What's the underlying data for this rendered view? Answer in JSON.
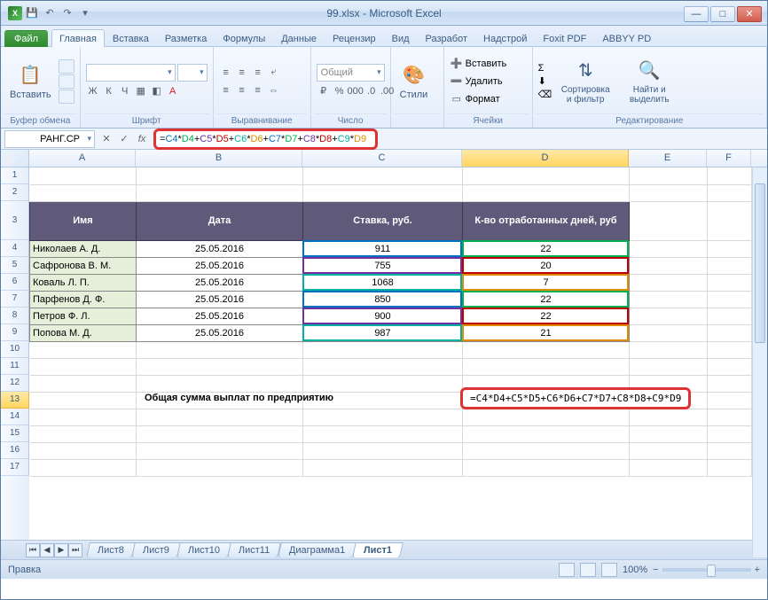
{
  "window": {
    "title": "99.xlsx - Microsoft Excel"
  },
  "tabs": {
    "file": "Файл",
    "items": [
      "Главная",
      "Вставка",
      "Разметка",
      "Формулы",
      "Данные",
      "Рецензир",
      "Вид",
      "Разработ",
      "Надстрой",
      "Foxit PDF",
      "ABBYY PD"
    ],
    "active": 0
  },
  "ribbon": {
    "clipboard": {
      "paste": "Вставить",
      "label": "Буфер обмена"
    },
    "font": {
      "label": "Шрифт",
      "bold": "Ж",
      "italic": "К",
      "underline": "Ч"
    },
    "align": {
      "label": "Выравнивание"
    },
    "number": {
      "format": "Общий",
      "label": "Число"
    },
    "styles": {
      "btn": "Стили",
      "label": ""
    },
    "cells": {
      "insert": "Вставить",
      "delete": "Удалить",
      "format": "Формат",
      "label": "Ячейки"
    },
    "editing": {
      "sort": "Сортировка и фильтр",
      "find": "Найти и выделить",
      "label": "Редактирование"
    }
  },
  "formula_bar": {
    "name_box": "РАНГ.СР",
    "parts": [
      {
        "t": "=",
        "c": ""
      },
      {
        "t": "C4",
        "c": "c1"
      },
      {
        "t": "*",
        "c": ""
      },
      {
        "t": "D4",
        "c": "c2"
      },
      {
        "t": "+",
        "c": ""
      },
      {
        "t": "C5",
        "c": "c3"
      },
      {
        "t": "*",
        "c": ""
      },
      {
        "t": "D5",
        "c": "c4"
      },
      {
        "t": "+",
        "c": ""
      },
      {
        "t": "C6",
        "c": "c5"
      },
      {
        "t": "*",
        "c": ""
      },
      {
        "t": "D6",
        "c": "c6"
      },
      {
        "t": "+",
        "c": ""
      },
      {
        "t": "C7",
        "c": "c1"
      },
      {
        "t": "*",
        "c": ""
      },
      {
        "t": "D7",
        "c": "c2"
      },
      {
        "t": "+",
        "c": ""
      },
      {
        "t": "C8",
        "c": "c3"
      },
      {
        "t": "*",
        "c": ""
      },
      {
        "t": "D8",
        "c": "c4"
      },
      {
        "t": "+",
        "c": ""
      },
      {
        "t": "C9",
        "c": "c5"
      },
      {
        "t": "*",
        "c": ""
      },
      {
        "t": "D9",
        "c": "c6"
      }
    ]
  },
  "columns": {
    "A": 120,
    "B": 188,
    "C": 180,
    "D": 188,
    "E": 88,
    "F": 50
  },
  "headers": {
    "A": "Имя",
    "B": "Дата",
    "C": "Ставка, руб.",
    "D": "К-во отработанных дней, руб"
  },
  "rows": [
    {
      "name": "Николаев А. Д.",
      "date": "25.05.2016",
      "rate": "911",
      "days": "22"
    },
    {
      "name": "Сафронова В. М.",
      "date": "25.05.2016",
      "rate": "755",
      "days": "20"
    },
    {
      "name": "Коваль Л. П.",
      "date": "25.05.2016",
      "rate": "1068",
      "days": "7"
    },
    {
      "name": "Парфенов Д. Ф.",
      "date": "25.05.2016",
      "rate": "850",
      "days": "22"
    },
    {
      "name": "Петров Ф. Л.",
      "date": "25.05.2016",
      "rate": "900",
      "days": "22"
    },
    {
      "name": "Попова М. Д.",
      "date": "25.05.2016",
      "rate": "987",
      "days": "21"
    }
  ],
  "summary": {
    "label": "Общая сумма выплат по предприятию",
    "formula": "=C4*D4+C5*D5+C6*D6+C7*D7+C8*D8+C9*D9"
  },
  "sheet_tabs": {
    "items": [
      "Лист8",
      "Лист9",
      "Лист10",
      "Лист11",
      "Диаграмма1",
      "Лист1"
    ],
    "active": 5
  },
  "status": {
    "mode": "Правка",
    "zoom": "100%"
  }
}
